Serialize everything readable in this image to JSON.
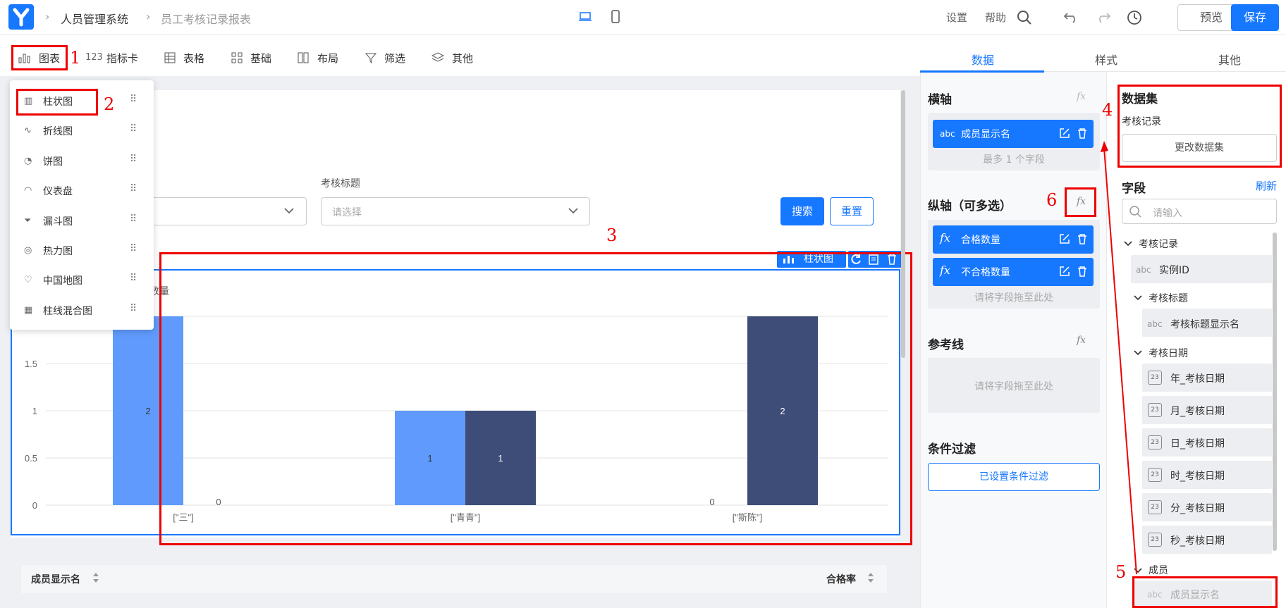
{
  "header": {
    "app_title": "人员管理系统",
    "report_title": "员工考核记录报表",
    "settings": "设置",
    "help": "帮助",
    "preview": "预览",
    "save": "保存"
  },
  "toolbar": {
    "items": [
      {
        "label": "图表"
      },
      {
        "label": "指标卡"
      },
      {
        "label": "表格"
      },
      {
        "label": "基础"
      },
      {
        "label": "布局"
      },
      {
        "label": "筛选"
      },
      {
        "label": "其他"
      }
    ],
    "icon_123": "123"
  },
  "dropdown": {
    "items": [
      {
        "label": "柱状图"
      },
      {
        "label": "折线图"
      },
      {
        "label": "饼图"
      },
      {
        "label": "仪表盘"
      },
      {
        "label": "漏斗图"
      },
      {
        "label": "热力图"
      },
      {
        "label": "中国地图"
      },
      {
        "label": "柱线混合图"
      }
    ]
  },
  "filters": {
    "field2_label": "考核标题",
    "placeholder": "请选择",
    "search": "搜索",
    "reset": "重置"
  },
  "chart_widget": {
    "badge": "柱状图",
    "legend_fragment": "数量"
  },
  "chart_data": {
    "type": "bar",
    "categories": [
      "[\"三\"]",
      "[\"青青\"]",
      "[\"斯陈\"]"
    ],
    "series": [
      {
        "values": [
          2,
          1,
          0
        ],
        "color": "#5f9afc"
      },
      {
        "values": [
          0,
          1,
          2
        ],
        "color": "#3e4d77"
      }
    ],
    "ylim": [
      0,
      2
    ],
    "yticks": [
      "0",
      "0.5",
      "1",
      "1.5"
    ],
    "grid": true
  },
  "table": {
    "col1": "成员显示名",
    "col2": "合格率"
  },
  "annotations": {
    "n1": "1",
    "n2": "2",
    "n3": "3",
    "n4": "4",
    "n5": "5",
    "n6": "6"
  },
  "config_panel": {
    "tabs": [
      "数据",
      "样式",
      "其他"
    ],
    "x_axis": {
      "title": "横轴",
      "field": "成员显示名",
      "field_tag": "abc",
      "hint": "最多 1 个字段"
    },
    "y_axis": {
      "title": "纵轴（可多选）",
      "fields": [
        "合格数量",
        "不合格数量"
      ],
      "hint": "请将字段拖至此处"
    },
    "ref_line": {
      "title": "参考线",
      "hint": "请将字段拖至此处"
    },
    "condition": {
      "title": "条件过滤",
      "button": "已设置条件过滤"
    },
    "fx": "fx"
  },
  "dataset_panel": {
    "title": "数据集",
    "name": "考核记录",
    "change_button": "更改数据集",
    "fields_title": "字段",
    "refresh": "刷新",
    "search_placeholder": "请输入",
    "tree": {
      "group1": "考核记录",
      "instance_id": "实例ID",
      "group_title": "考核标题",
      "title_display": "考核标题显示名",
      "group_date": "考核日期",
      "date_fields": [
        "年_考核日期",
        "月_考核日期",
        "日_考核日期",
        "时_考核日期",
        "分_考核日期",
        "秒_考核日期"
      ],
      "group_member": "成员",
      "member_display": "成员显示名",
      "tag_abc": "abc",
      "tag_date": "23"
    }
  }
}
